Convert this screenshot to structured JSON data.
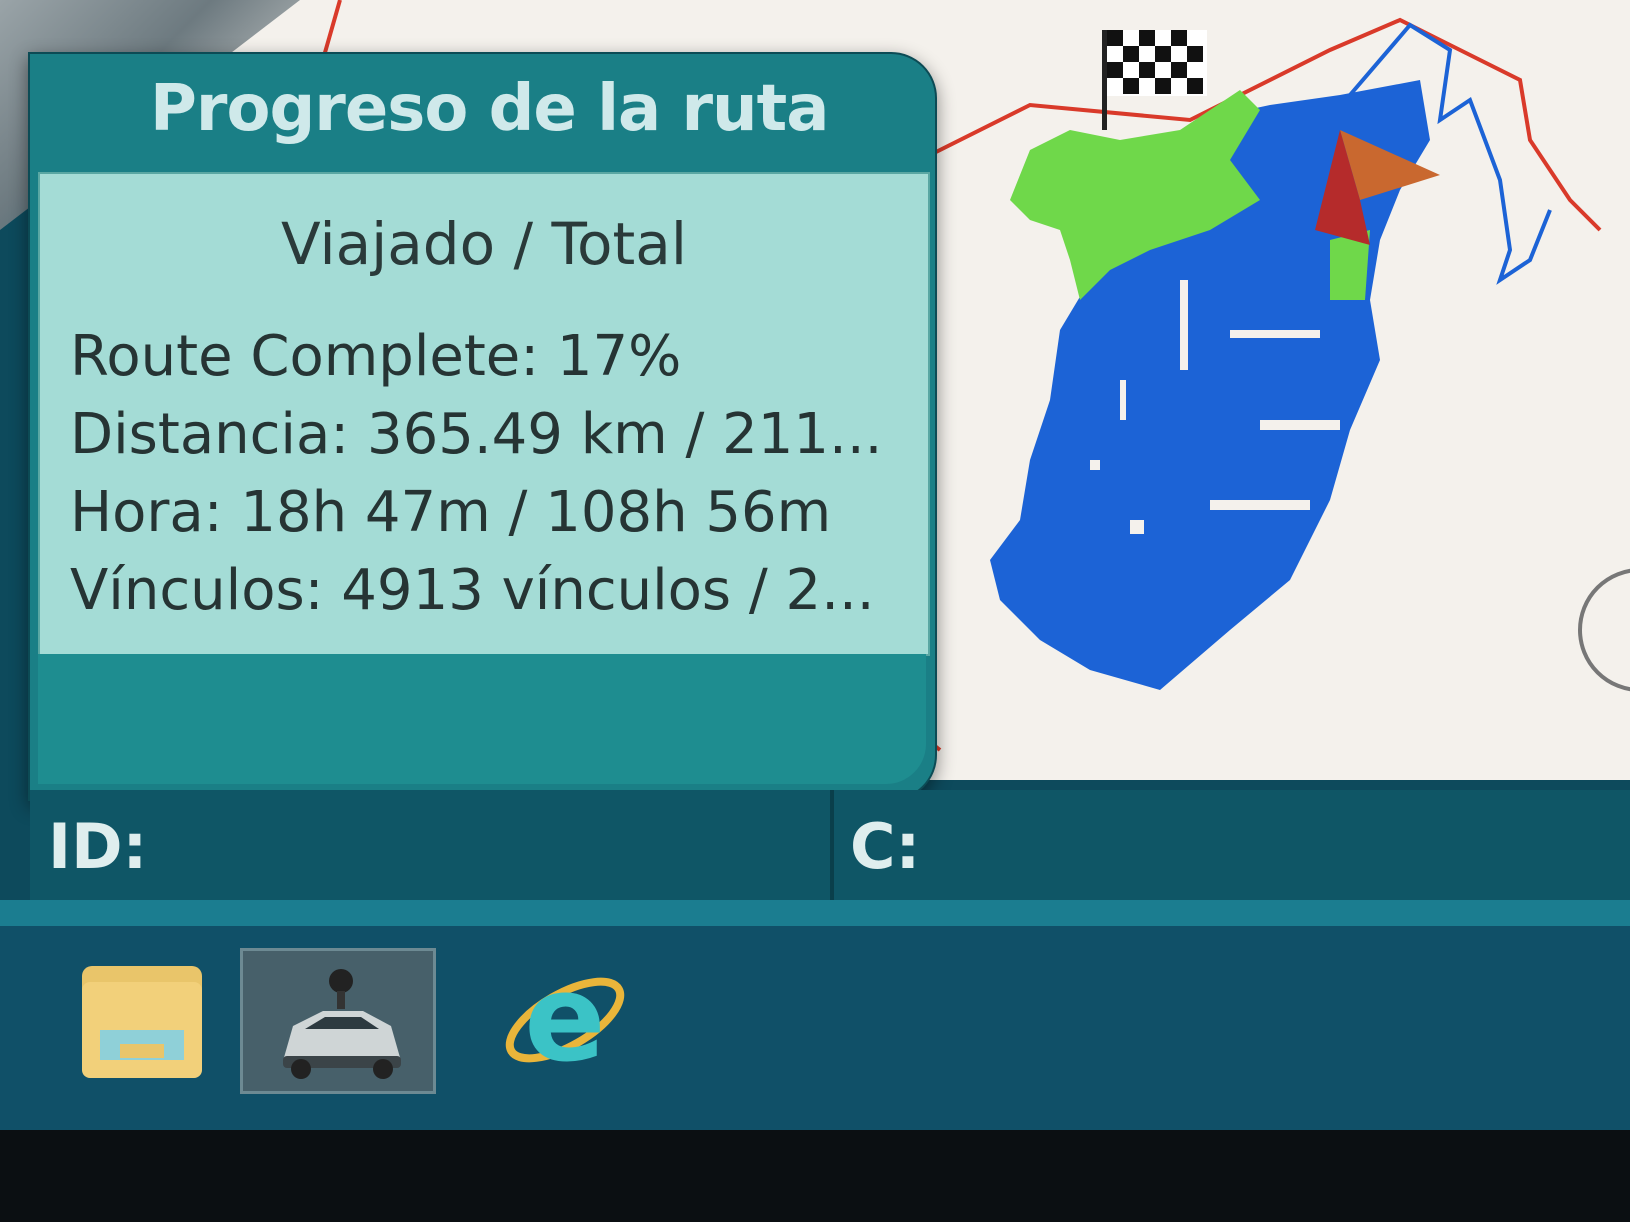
{
  "dialog": {
    "title": "Progreso de la ruta",
    "subtitle": "Viajado / Total",
    "stats": [
      {
        "label": "Route Complete: 17%"
      },
      {
        "label": "Distancia: 365.49 km / 211..."
      },
      {
        "label": "Hora: 18h 47m / 108h 56m"
      },
      {
        "label": "Vínculos: 4913 vínculos / 2..."
      }
    ]
  },
  "infobar": {
    "id_label": "ID:",
    "c_label": "C:"
  },
  "taskbar": {
    "items": [
      {
        "icon": "folder-icon"
      },
      {
        "icon": "car-icon",
        "active": true
      },
      {
        "icon": "internet-explorer-icon"
      }
    ]
  },
  "colors": {
    "route_done": "#6fd84a",
    "route_remaining": "#1c63d6",
    "road_line": "#d93a2a",
    "dialog_bg": "#1a7f86",
    "dialog_body": "#a4dcd6"
  }
}
